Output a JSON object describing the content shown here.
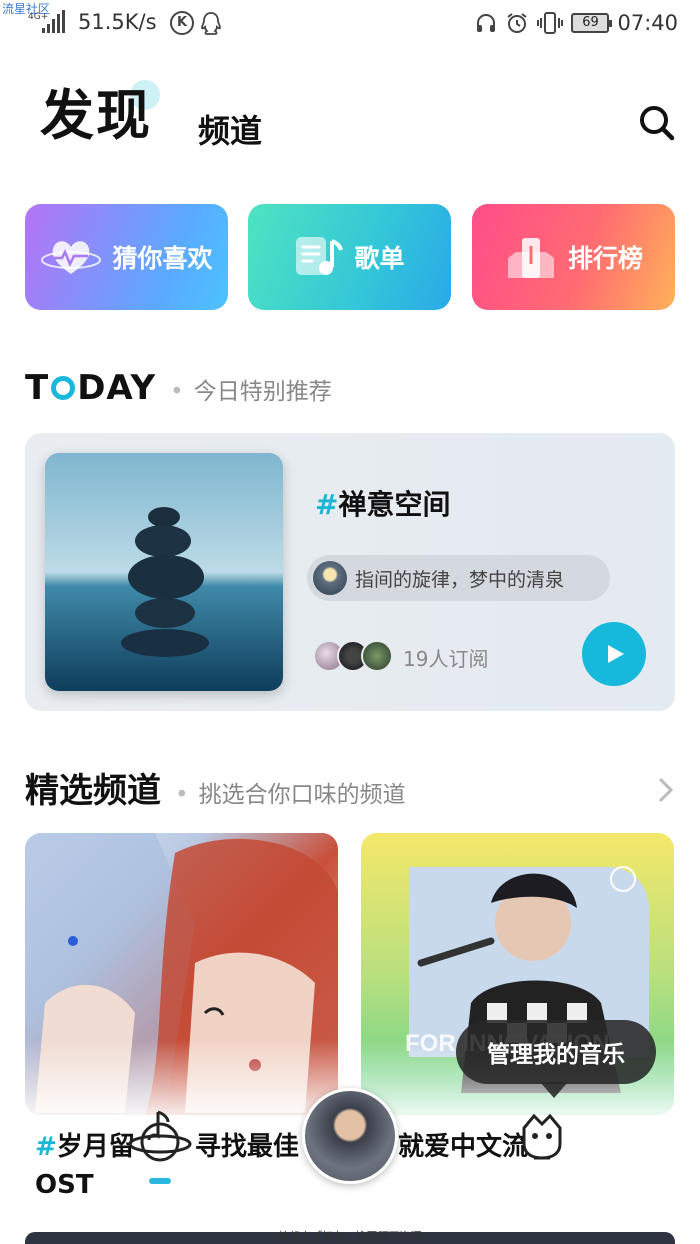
{
  "status_bar": {
    "watermark": "流星社区",
    "network_badge": "4G+",
    "speed": "51.5K/s",
    "k_badge": "K",
    "battery": "69",
    "time": "07:40"
  },
  "header": {
    "title": "发现",
    "channel_tab": "频道"
  },
  "quick_links": [
    {
      "label": "猜你喜欢",
      "icon": "heart-icon"
    },
    {
      "label": "歌单",
      "icon": "playlist-icon"
    },
    {
      "label": "排行榜",
      "icon": "ranking-icon"
    }
  ],
  "today": {
    "heading_pre": "T",
    "heading_post": "DAY",
    "subtitle": "今日特别推荐",
    "card": {
      "hash": "#",
      "title": "禅意空间",
      "desc": "指间的旋律，梦中的清泉",
      "subscribers": "19人订阅"
    }
  },
  "featured": {
    "title": "精选频道",
    "subtitle": "挑选合你口味的频道",
    "channels": [
      {
        "hash": "#",
        "title": "岁月留",
        "title_tail": "寻找最佳",
        "line2": "OST"
      },
      {
        "title": "就爱中文流",
        "poster_text": "FOR INNOVATION"
      }
    ]
  },
  "tooltip": "管理我的音乐",
  "footer_note": "搞机上「智友」搜同题下资源",
  "colors": {
    "accent": "#16b8dc",
    "text_primary": "#111111",
    "text_secondary": "#888888"
  }
}
